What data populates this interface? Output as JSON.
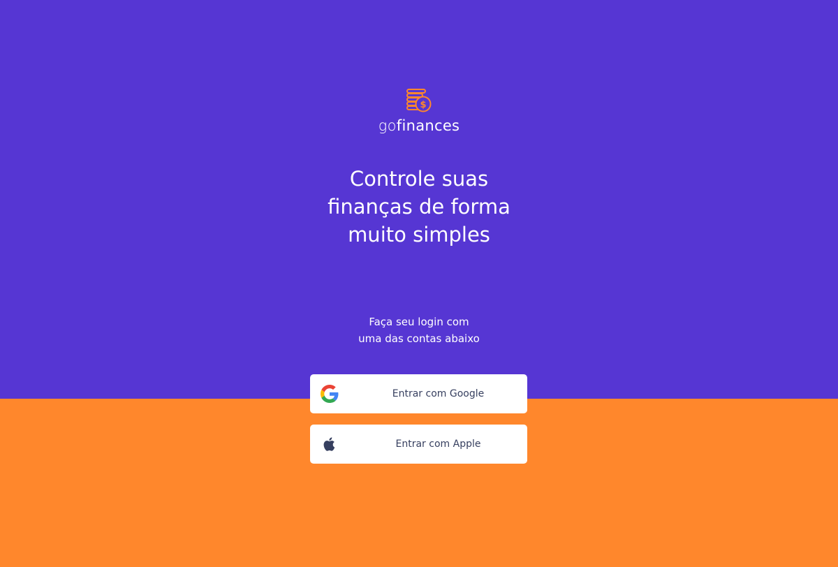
{
  "logo": {
    "word_part_1": "go",
    "word_part_2": "finances",
    "icon": "coins-dollar-icon",
    "accent_color": "#FF872C"
  },
  "headline": {
    "line1": "Controle suas",
    "line2": "finanças de forma",
    "line3": "muito simples"
  },
  "subtitle": {
    "line1": "Faça seu login com",
    "line2": "uma das contas abaixo"
  },
  "buttons": {
    "google": {
      "label": "Entrar com Google",
      "icon": "google-icon"
    },
    "apple": {
      "label": "Entrar com Apple",
      "icon": "apple-icon"
    }
  },
  "colors": {
    "primary": "#5636D3",
    "secondary": "#FF872C",
    "button_text": "#363F5F",
    "white": "#FFFFFF"
  }
}
